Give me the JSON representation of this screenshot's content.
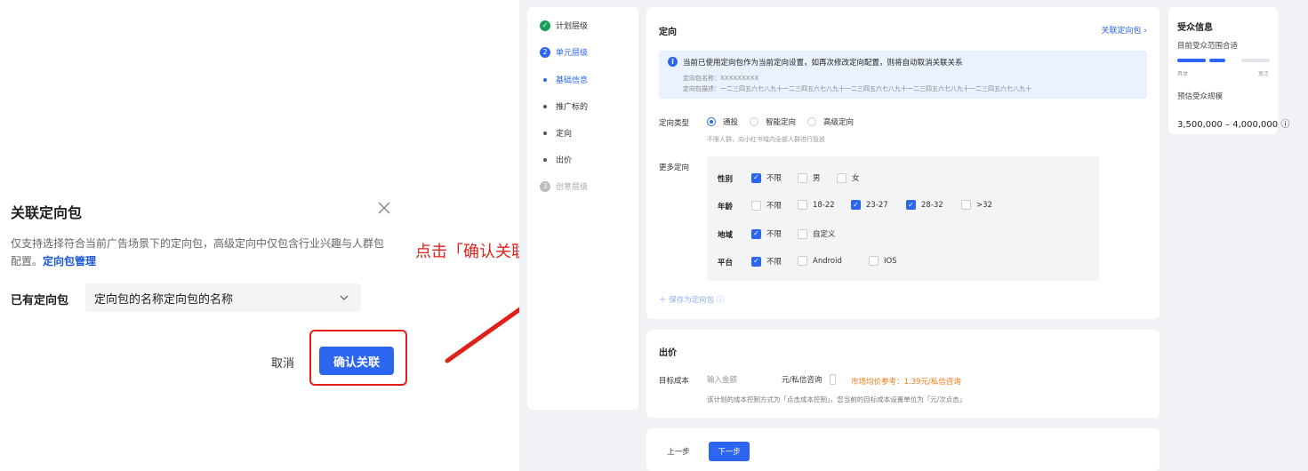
{
  "dialog": {
    "title": "关联定向包",
    "desc_text": "仅支持选择符合当前广告场景下的定向包，高级定向中仅包含行业兴趣与人群包配置。",
    "desc_link": "定向包管理",
    "label": "已有定向包",
    "select_value": "定向包的名称定向包的名称",
    "cancel_label": "取消",
    "ok_label": "确认关联"
  },
  "annotation": {
    "text": "点击「确认关联」，返回创编界面"
  },
  "steps": [
    {
      "label": "计划层级",
      "state": "done",
      "marker": "✓"
    },
    {
      "label": "单元层级",
      "state": "active",
      "marker": "2"
    },
    {
      "label": "基础信息",
      "state": "sub-active"
    },
    {
      "label": "推广标的",
      "state": "sub"
    },
    {
      "label": "定向",
      "state": "sub"
    },
    {
      "label": "出价",
      "state": "sub"
    },
    {
      "label": "创意层级",
      "state": "todo",
      "marker": "3"
    }
  ],
  "targeting": {
    "title": "定向",
    "link": "关联定向包 ›",
    "info_main": "当前已使用定向包作为当前定向设置，如再次修改定向配置，则将自动取消关联关系",
    "info_name": "定向包名称：XXXXXXXXX",
    "info_desc": "定向包描述：一二三四五六七八九十一二三四五六七八九十一二三四五六七八九十一二三四五六七八九十一二三四五六七八九十",
    "type_label": "定向类型",
    "type_options": [
      {
        "label": "通投",
        "selected": true
      },
      {
        "label": "智能定向",
        "selected": false
      },
      {
        "label": "高级定向",
        "selected": false
      }
    ],
    "type_hint": "不限人群，向小红书域内全部人群进行投放",
    "more_label": "更多定向",
    "groups": [
      {
        "label": "性别",
        "options": [
          {
            "label": "不限",
            "checked": true
          },
          {
            "label": "男",
            "checked": false
          },
          {
            "label": "女",
            "checked": false
          }
        ]
      },
      {
        "label": "年龄",
        "options": [
          {
            "label": "不限",
            "checked": false
          },
          {
            "label": "18-22",
            "checked": false
          },
          {
            "label": "23-27",
            "checked": true
          },
          {
            "label": "28-32",
            "checked": true
          },
          {
            "label": ">32",
            "checked": false
          }
        ]
      },
      {
        "label": "地域",
        "options": [
          {
            "label": "不限",
            "checked": true
          },
          {
            "label": "自定义",
            "checked": false
          }
        ]
      },
      {
        "label": "平台",
        "options": [
          {
            "label": "不限",
            "checked": true
          },
          {
            "label": "Android",
            "checked": false
          },
          {
            "label": "IOS",
            "checked": false
          }
        ]
      }
    ],
    "save_label": "＋ 保存为定向包 ⓘ"
  },
  "bid": {
    "title": "出价",
    "cost_label": "目标成本",
    "placeholder": "输入金额",
    "unit": "元/私信咨询",
    "market_ref": "市场均价参考：1.39元/私信咨询",
    "hint": "该计划的成本控制方式为「点击成本控制」，您当前的目标成本设置单位为「元/次点击」"
  },
  "nav": {
    "prev": "上一步",
    "next": "下一步"
  },
  "audience": {
    "title": "受众信息",
    "status": "目前受众范围合适",
    "left_tag": "具体",
    "right_tag": "宽泛",
    "level": 0.5,
    "estimate_label": "预估受众规模",
    "estimate_range": "3,500,000 – 4,000,000 ⓘ",
    "colors": {
      "active": "#2b65f0",
      "inactive": "#e3e6eb"
    }
  }
}
